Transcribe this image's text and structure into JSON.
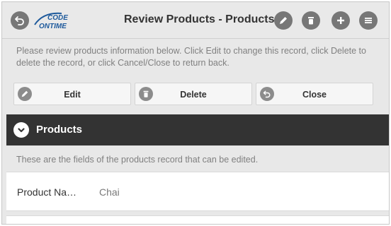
{
  "header": {
    "title": "Review Products - Products",
    "logo_line1": "CODE",
    "logo_line2": "ONTIME"
  },
  "description": "Please review products information below. Click Edit to change this record, click Delete to delete the record, or click Cancel/Close to return back.",
  "actions": {
    "edit_label": "Edit",
    "delete_label": "Delete",
    "close_label": "Close"
  },
  "category": {
    "title": "Products",
    "description": "These are the fields of the products record that can be edited."
  },
  "fields": [
    {
      "label": "Product Na…",
      "value": "Chai"
    }
  ],
  "icons": {
    "back": "back-arrow-icon",
    "edit": "pencil-icon",
    "delete": "trash-icon",
    "add": "plus-icon",
    "menu": "hamburger-menu-icon",
    "toggle": "chevron-down-icon"
  },
  "colors": {
    "header_bg": "#e9e9e9",
    "category_bar_bg": "#333333",
    "icon_fill": "#777777",
    "logo_blue": "#1e5a9c"
  }
}
